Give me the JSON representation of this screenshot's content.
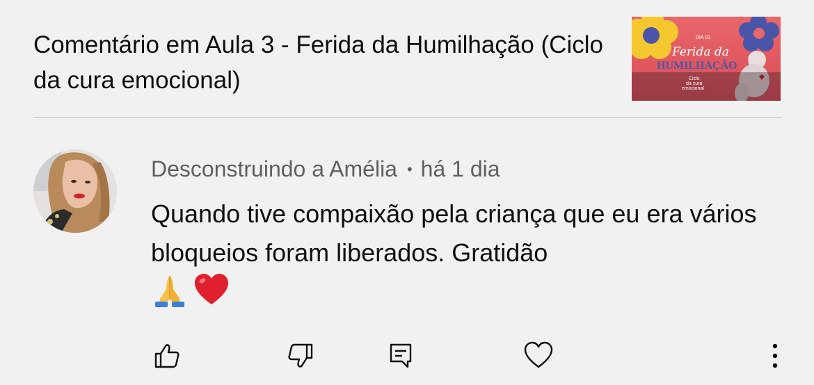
{
  "header": {
    "title": "Comentário em Aula 3 - Ferida da Humilhação (Ciclo da cura emocional)",
    "thumbnail": {
      "day_label": "DIA 03",
      "title_line1": "Ferida da",
      "title_line2": "HUMILHAÇÃO",
      "subtitle_line1": "Ciclo",
      "subtitle_line2": "da cura",
      "subtitle_line3": "emocional"
    }
  },
  "comment": {
    "author": "Desconstruindo a Amélia",
    "separator": "•",
    "time": "há 1 dia",
    "text": "Quando tive compaixão pela criança que eu era vários bloqueios foram liberados. Gratidão",
    "emojis": [
      "praying-hands",
      "red-heart"
    ]
  },
  "actions": {
    "like_icon": "thumbs-up-icon",
    "dislike_icon": "thumbs-down-icon",
    "reply_icon": "comment-icon",
    "heart_icon": "heart-outline-icon",
    "more_icon": "more-vertical-icon"
  },
  "colors": {
    "background": "#f1f1f1",
    "text_primary": "#0f0f0f",
    "text_secondary": "#606060",
    "divider": "#d7d7d7",
    "thumb_red": "#e2585d"
  }
}
